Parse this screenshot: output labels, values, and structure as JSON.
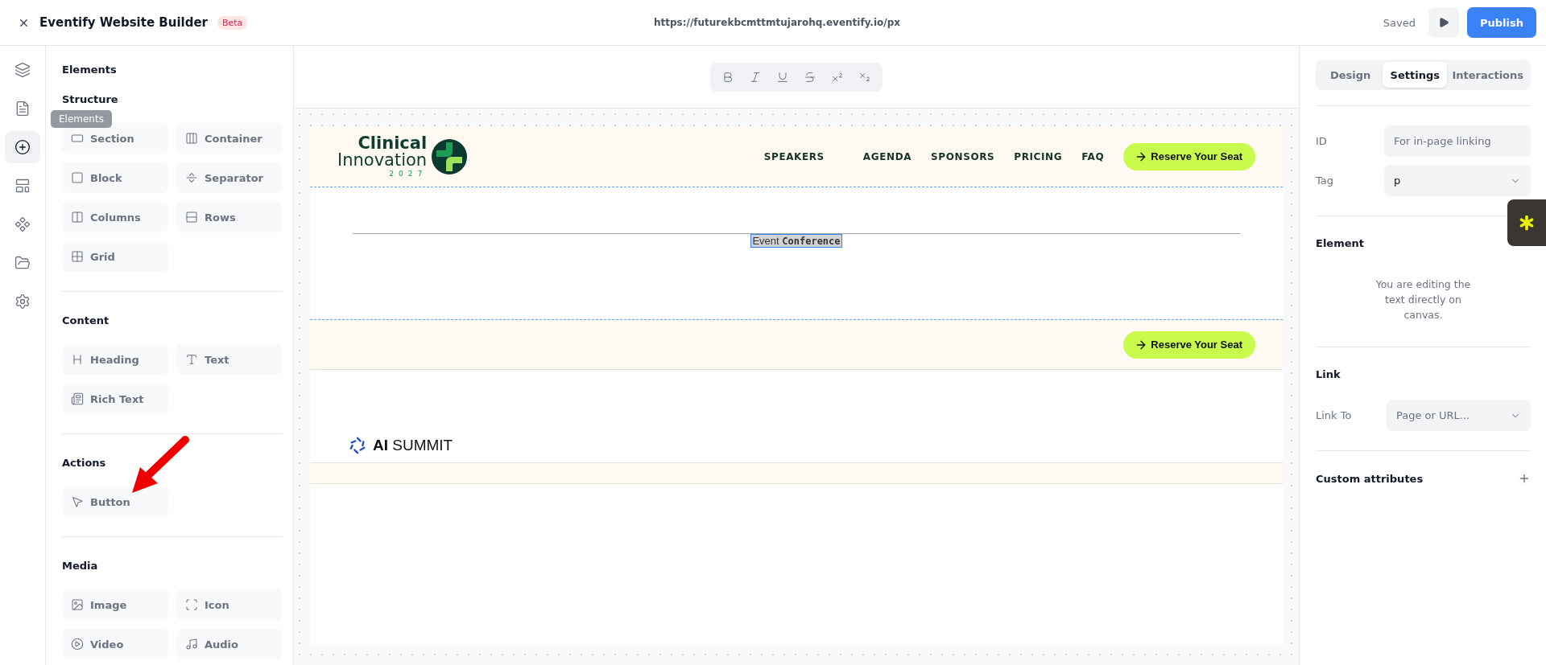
{
  "topbar": {
    "title": "Eventify Website Builder",
    "badge": "Beta",
    "url": "https://futurekbcmttmtujarohq.eventify.io/px",
    "status": "Saved",
    "publish": "Publish"
  },
  "rail": [
    {
      "kind": "layers",
      "selected": false
    },
    {
      "kind": "pages",
      "selected": false
    },
    {
      "kind": "add",
      "selected": true
    },
    {
      "kind": "layout",
      "selected": false
    },
    {
      "kind": "components",
      "selected": false
    },
    {
      "kind": "files",
      "selected": false
    },
    {
      "kind": "settings",
      "selected": false
    }
  ],
  "tooltip": "Elements",
  "panel": {
    "title": "Elements",
    "groups": [
      {
        "title": "Structure",
        "items": [
          {
            "label": "Section",
            "kind": "section"
          },
          {
            "label": "Container",
            "kind": "container"
          },
          {
            "label": "Block",
            "kind": "block"
          },
          {
            "label": "Separator",
            "kind": "separator"
          },
          {
            "label": "Columns",
            "kind": "columns"
          },
          {
            "label": "Rows",
            "kind": "rows"
          },
          {
            "label": "Grid",
            "kind": "grid"
          }
        ]
      },
      {
        "title": "Content",
        "items": [
          {
            "label": "Heading",
            "kind": "heading"
          },
          {
            "label": "Text",
            "kind": "text"
          },
          {
            "label": "Rich Text",
            "kind": "richtext"
          }
        ]
      },
      {
        "title": "Actions",
        "items": [
          {
            "label": "Button",
            "kind": "button"
          }
        ]
      },
      {
        "title": "Media",
        "items": [
          {
            "label": "Image",
            "kind": "image"
          },
          {
            "label": "Icon",
            "kind": "icon"
          },
          {
            "label": "Video",
            "kind": "video"
          },
          {
            "label": "Audio",
            "kind": "audio"
          }
        ]
      }
    ]
  },
  "format_tools": [
    {
      "kind": "bold"
    },
    {
      "kind": "italic"
    },
    {
      "kind": "underline"
    },
    {
      "kind": "strike"
    },
    {
      "kind": "superscript"
    },
    {
      "kind": "subscript"
    }
  ],
  "canvas": {
    "logo": {
      "line1": "Clinical",
      "line2": "Innovation",
      "line3": "2027"
    },
    "nav": [
      "SPEAKERS",
      "AGENDA",
      "SPONSORS",
      "PRICING",
      "FAQ"
    ],
    "cta": "Reserve Your Seat",
    "selected_text": "Event **Conference**",
    "cta_2": "Reserve Your Seat",
    "brand": {
      "strong": "AI",
      "rest": "SUMMIT"
    }
  },
  "inspector": {
    "tabs": [
      {
        "label": "Design",
        "selected": false
      },
      {
        "label": "Settings",
        "selected": true
      },
      {
        "label": "Interactions",
        "selected": false
      }
    ],
    "fields": [
      {
        "label": "ID",
        "kind": "input",
        "placeholder": "For in-page linking"
      },
      {
        "label": "Tag",
        "kind": "select",
        "value": "p"
      }
    ],
    "element": {
      "title": "Element",
      "note": "You are editing the text directly on canvas."
    },
    "link": {
      "title": "Link",
      "label": "Link To",
      "placeholder": "Page or URL..."
    },
    "custom": "Custom attributes"
  }
}
